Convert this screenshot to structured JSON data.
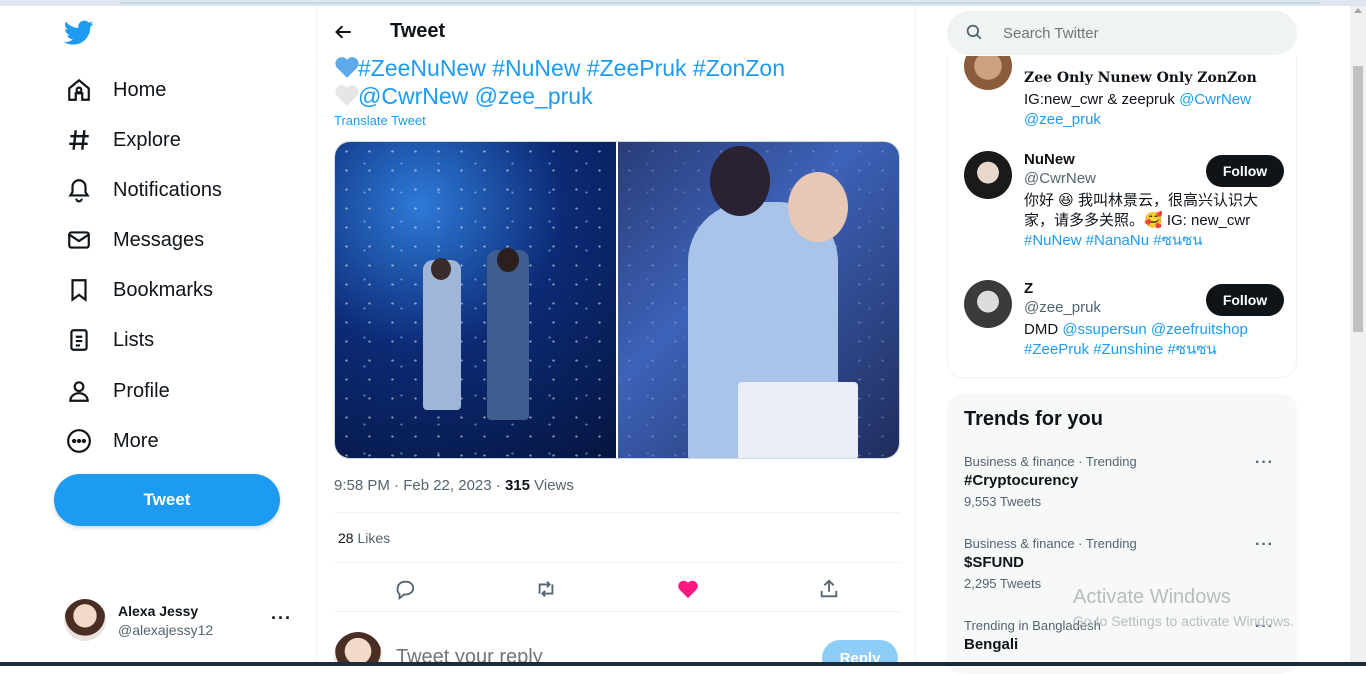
{
  "nav": {
    "items": [
      {
        "label": "Home",
        "icon": "home-icon"
      },
      {
        "label": "Explore",
        "icon": "hashtag-icon"
      },
      {
        "label": "Notifications",
        "icon": "bell-icon"
      },
      {
        "label": "Messages",
        "icon": "mail-icon"
      },
      {
        "label": "Bookmarks",
        "icon": "bookmark-icon"
      },
      {
        "label": "Lists",
        "icon": "lists-icon"
      },
      {
        "label": "Profile",
        "icon": "person-icon"
      },
      {
        "label": "More",
        "icon": "more-circle-icon"
      }
    ],
    "tweet_button": "Tweet",
    "account": {
      "name": "Alexa Jessy",
      "handle": "@alexajessy12"
    }
  },
  "tweet": {
    "header_title": "Tweet",
    "line1": "#ZeeNuNew #NuNew #ZeePruk #ZonZon",
    "line2": "@CwrNew @zee_pruk",
    "translate": "Translate Tweet",
    "time": "9:58 PM · Feb 22, 2023 · ",
    "views_count": "315",
    "views_label": " Views",
    "likes_count": "28",
    "likes_label": " Likes",
    "reply_placeholder": "Tweet your reply",
    "reply_button": "Reply"
  },
  "search": {
    "placeholder": "Search Twitter"
  },
  "relevant": [
    {
      "name": "Zee Only Nunew Only ZonZon",
      "handle": "",
      "bio_plain": "IG:new_cwr & zeepruk ",
      "bio_links": "@CwrNew @zee_pruk",
      "follow": ""
    },
    {
      "name": "NuNew",
      "handle": "@CwrNew",
      "bio_plain": "你好 😆 我叫林景云，很高兴认识大家，请多多关照。🥰 IG: new_cwr",
      "bio_links": "#NuNew #NanaNu #ซนซน",
      "follow": "Follow"
    },
    {
      "name": "Z",
      "handle": "@zee_pruk",
      "bio_plain": "DMD ",
      "bio_links": "@ssupersun @zeefruitshop #ZeePruk #Zunshine #ซนซน",
      "follow": "Follow"
    }
  ],
  "trends": {
    "title": "Trends for you",
    "items": [
      {
        "context": "Business & finance · Trending",
        "topic": "#Cryptocurency",
        "count": "9,553 Tweets"
      },
      {
        "context": "Business & finance · Trending",
        "topic": "$SFUND",
        "count": "2,295 Tweets"
      },
      {
        "context": "Trending in Bangladesh",
        "topic": "Bengali",
        "count": ""
      }
    ]
  },
  "watermark": {
    "line1": "Activate Windows",
    "line2": "Go to Settings to activate Windows."
  },
  "colors": {
    "accent": "#1d9bf0",
    "like": "#f91880",
    "text": "#0f1419",
    "muted": "#536471"
  }
}
